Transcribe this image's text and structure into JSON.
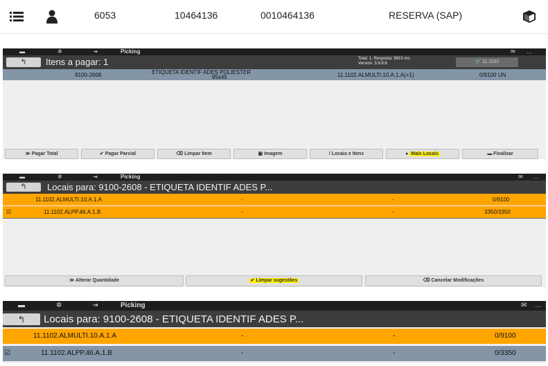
{
  "top_row": {
    "menu_icon": "list-icon",
    "user_icon": "person-icon",
    "code": "6053",
    "number1": "10464136",
    "number2": "0010464136",
    "type": "RESERVA (SAP)",
    "box_icon": "box-icon"
  },
  "panel1": {
    "bar": {
      "menu_icon": "menu-icon",
      "gear_icon": "gear-icon",
      "exit_icon": "exit-icon",
      "label": "Picking",
      "right_icon": "message-icon",
      "right_text": "…"
    },
    "title": "Itens a pagar: 1",
    "info_line1": "Total: 1. Resposta: 9810 ms.",
    "info_line2": "Version: 3.9.8.8",
    "cart_text": "11.1102",
    "item": {
      "code": "9100-2608",
      "description_line1": "ETIQUETA IDENTIF ADES POLIESTER",
      "description_line2": "95x45",
      "location": "11.1102.ALMULTI.10.A.1.A(+1)",
      "quantity": "0/9100 UN"
    },
    "buttons": [
      "Pagar Total",
      "Pagar Parcial",
      "Limpar Item",
      "Imagem",
      "Locais e Itens",
      "Mais Locais",
      "Finalizar"
    ]
  },
  "panel2": {
    "bar": {
      "label": "Picking",
      "right_text": "…"
    },
    "title": "Locais para: 9100-2608 - ETIQUETA IDENTIF ADES P...",
    "rows": [
      {
        "location": "11.1102.ALMULTI.10.A.1.A",
        "col2": "-",
        "col3": "-",
        "qty": "0/9100"
      },
      {
        "location": "11.1102.ALPP.46.A.1.B",
        "col2": "-",
        "col3": "-",
        "qty": "3350/3350"
      }
    ],
    "buttons": [
      "Alterar Quantidade",
      "Limpar sugestões",
      "Cancelar Modificações"
    ]
  },
  "panel3": {
    "bar": {
      "label": "Picking",
      "right_text": "…"
    },
    "title": "Locais para: 9100-2608 - ETIQUETA IDENTIF ADES P...",
    "rows": [
      {
        "location": "11.1102.ALMULTI.10.A.1.A",
        "col2": "-",
        "col3": "-",
        "qty": "0/9100"
      },
      {
        "location": "11.1102.ALPP.46.A.1.B",
        "col2": "-",
        "col3": "-",
        "qty": "0/3350"
      }
    ]
  },
  "colors": {
    "orange": "#ffa500",
    "steel": "#8395a7",
    "bar": "#1e1e1e",
    "title": "#3d3d3d",
    "highlight": "#ffec00"
  }
}
